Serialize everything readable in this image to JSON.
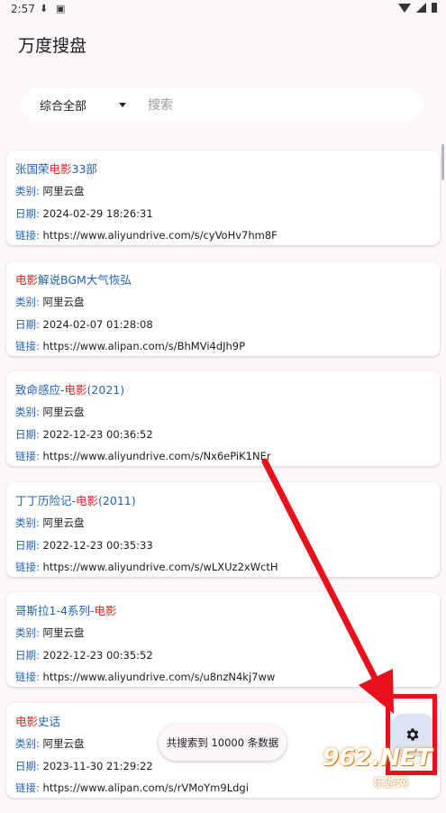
{
  "status_bar": {
    "time": "2:57",
    "icons": [
      "download-icon",
      "photo-icon",
      "wifi-icon",
      "signal-icon",
      "battery-icon"
    ]
  },
  "app": {
    "title": "万度搜盘"
  },
  "search": {
    "category_selected": "综合全部",
    "placeholder": "搜索"
  },
  "results": [
    {
      "title_parts": [
        {
          "text": "张国荣",
          "hl": false
        },
        {
          "text": "电影",
          "hl": true
        },
        {
          "text": "33部",
          "hl": false
        }
      ],
      "type_label": "类别:",
      "type": "阿里云盘",
      "date_label": "日期:",
      "date": "2024-02-29 18:26:31",
      "link_label": "链接:",
      "link": "https://www.aliyundrive.com/s/cyVoHv7hm8F"
    },
    {
      "title_parts": [
        {
          "text": "电影",
          "hl": true
        },
        {
          "text": "解说BGM大气恢弘",
          "hl": false
        }
      ],
      "type_label": "类别:",
      "type": "阿里云盘",
      "date_label": "日期:",
      "date": "2024-02-07 01:28:08",
      "link_label": "链接:",
      "link": "https://www.alipan.com/s/BhMVi4dJh9P"
    },
    {
      "title_parts": [
        {
          "text": "致命感应-",
          "hl": false
        },
        {
          "text": "电影",
          "hl": true
        },
        {
          "text": "(2021)",
          "hl": false
        }
      ],
      "type_label": "类别:",
      "type": "阿里云盘",
      "date_label": "日期:",
      "date": "2022-12-23 00:36:52",
      "link_label": "链接:",
      "link": "https://www.aliyundrive.com/s/Nx6ePiK1NEr"
    },
    {
      "title_parts": [
        {
          "text": "丁丁历险记-",
          "hl": false
        },
        {
          "text": "电影",
          "hl": true
        },
        {
          "text": "(2011)",
          "hl": false
        }
      ],
      "type_label": "类别:",
      "type": "阿里云盘",
      "date_label": "日期:",
      "date": "2022-12-23 00:35:33",
      "link_label": "链接:",
      "link": "https://www.aliyundrive.com/s/wLXUz2xWctH"
    },
    {
      "title_parts": [
        {
          "text": "哥斯拉1-4系列-",
          "hl": false
        },
        {
          "text": "电影",
          "hl": true
        }
      ],
      "type_label": "类别:",
      "type": "阿里云盘",
      "date_label": "日期:",
      "date": "2022-12-23 00:35:52",
      "link_label": "链接:",
      "link": "https://www.aliyundrive.com/s/u8nzN4kj7ww"
    },
    {
      "title_parts": [
        {
          "text": "电影",
          "hl": true
        },
        {
          "text": "史话",
          "hl": false
        }
      ],
      "type_label": "类别:",
      "type": "阿里云盘",
      "date_label": "日期:",
      "date": "2023-11-30 21:29:22",
      "link_label": "链接:",
      "link": "https://www.alipan.com/s/rVMoYm9Ldgi"
    }
  ],
  "toast": "共搜索到 10000 条数据",
  "fab": {
    "icon": "gear-icon"
  },
  "watermark": {
    "big": "962.NET",
    "small": "乐游网"
  },
  "colors": {
    "link_blue": "#1f63b5",
    "highlight_red": "#e0221c",
    "annotation_red": "#e8101a",
    "background": "#fdf7fb"
  }
}
